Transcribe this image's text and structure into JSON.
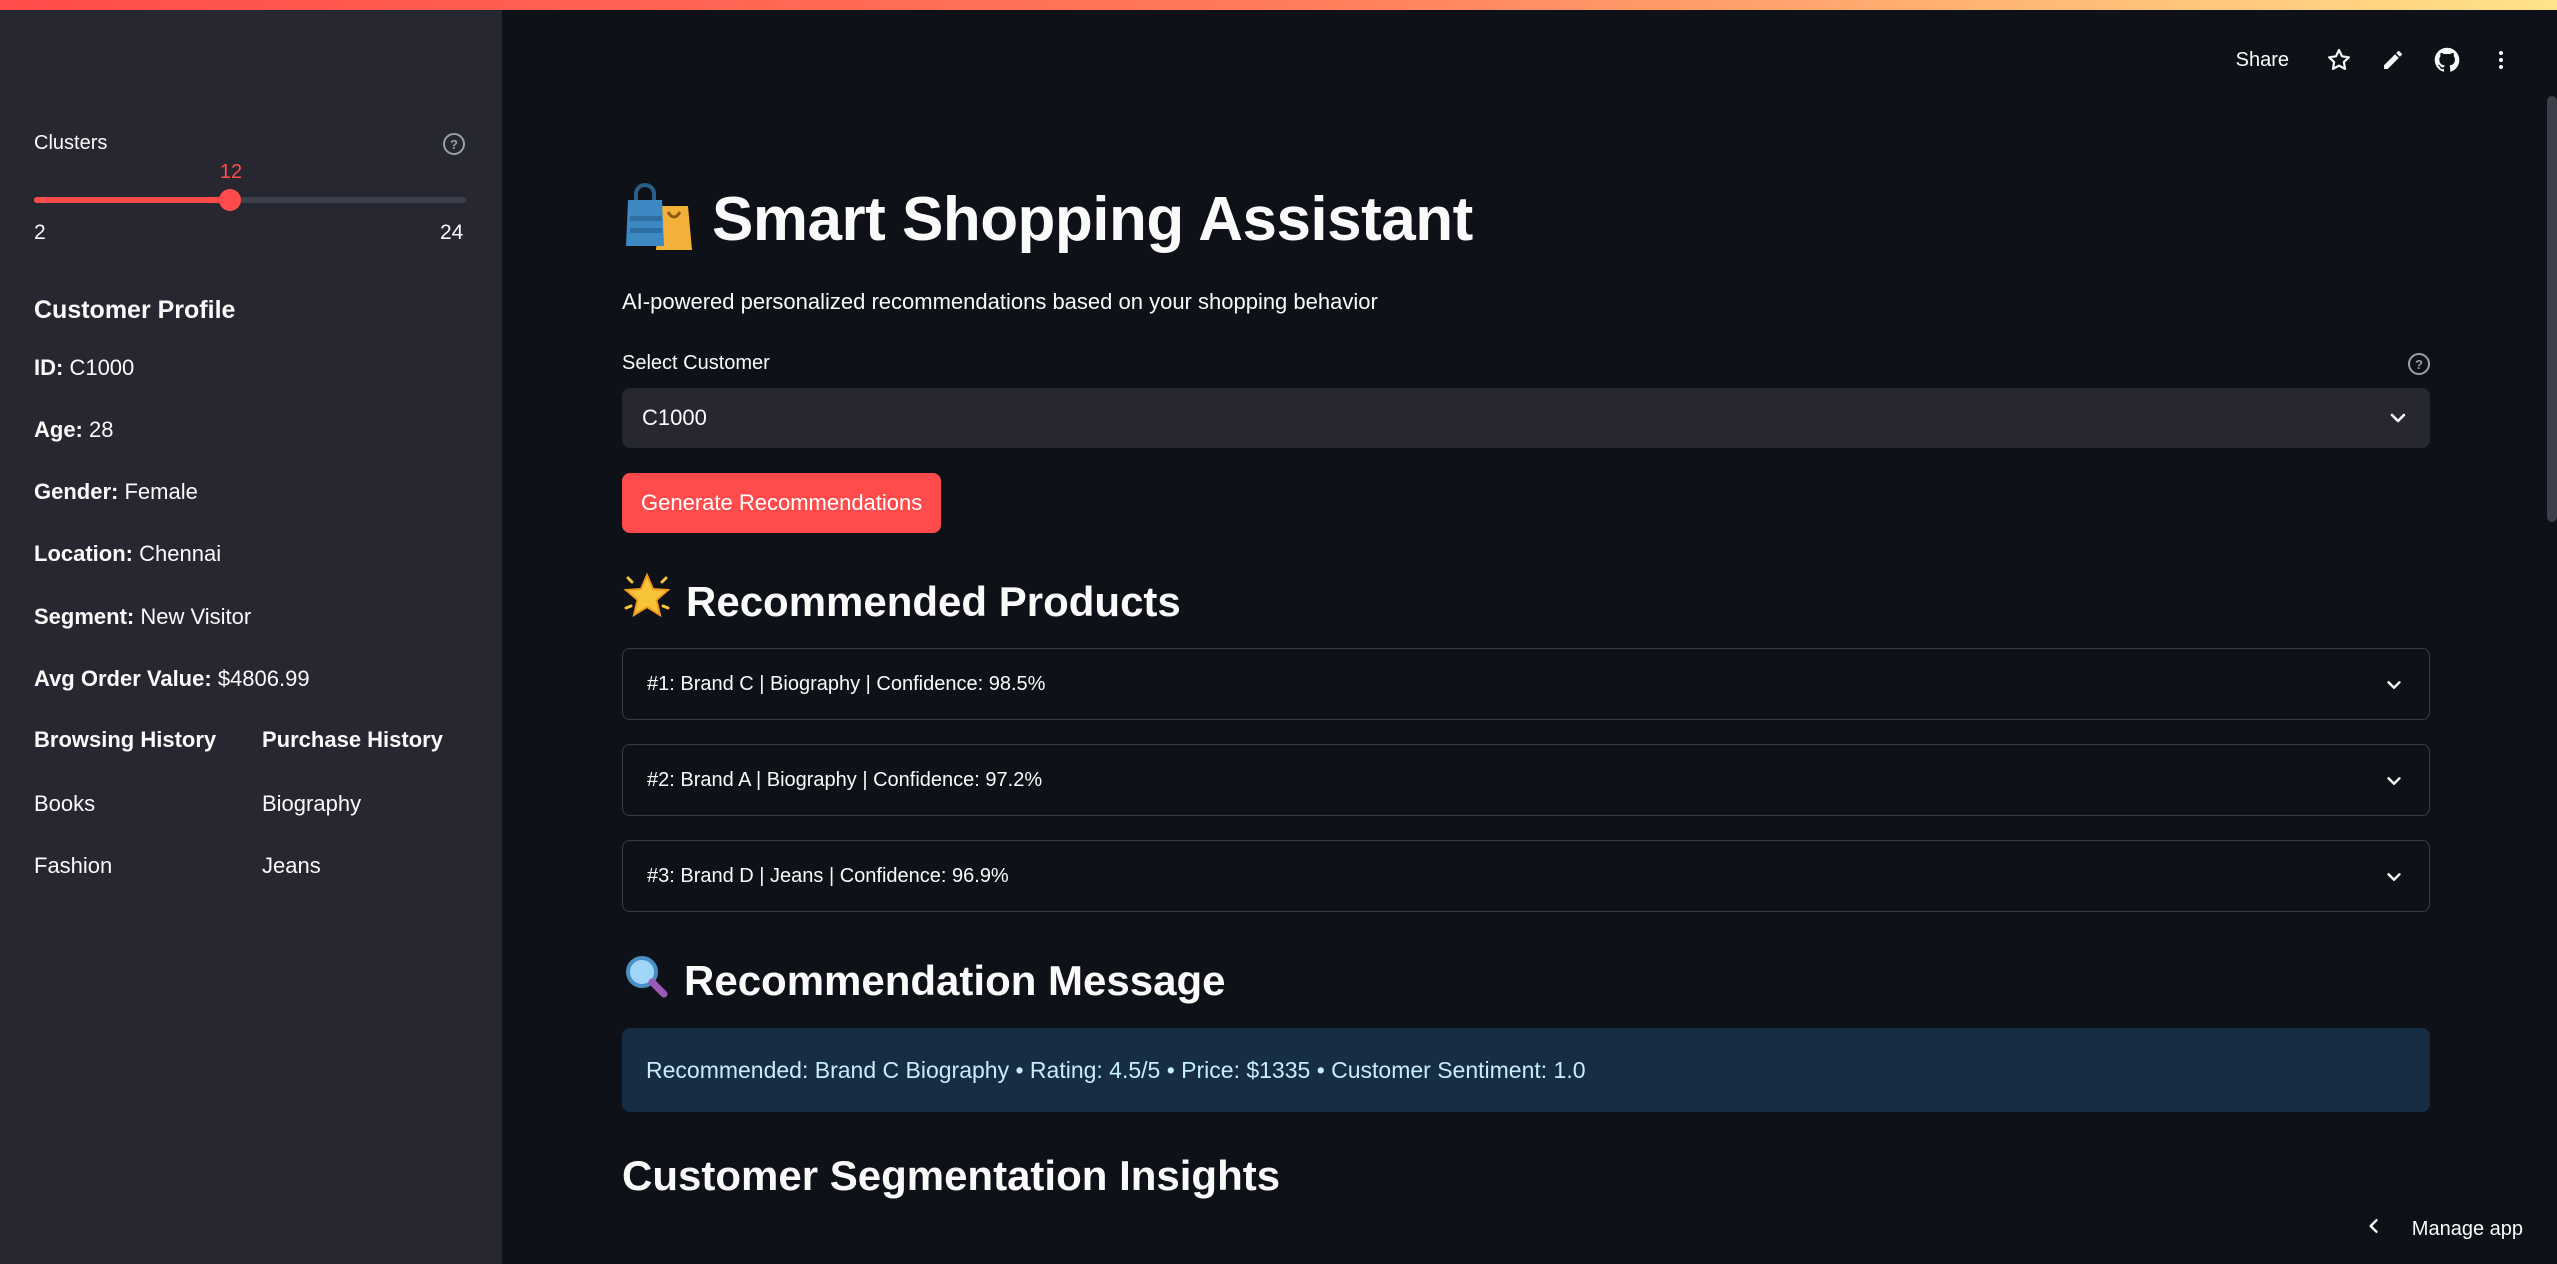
{
  "sidebar": {
    "slider": {
      "label": "Clusters",
      "value": "12",
      "min": "2",
      "max": "24",
      "fraction": 0.4545
    },
    "profile": {
      "title": "Customer Profile",
      "rows": [
        {
          "key": "ID:",
          "value": "C1000"
        },
        {
          "key": "Age:",
          "value": "28"
        },
        {
          "key": "Gender:",
          "value": "Female"
        },
        {
          "key": "Location:",
          "value": "Chennai"
        },
        {
          "key": "Segment:",
          "value": "New Visitor"
        },
        {
          "key": "Avg Order Value:",
          "value": "$4806.99"
        }
      ]
    },
    "browsing": {
      "title": "Browsing History",
      "items": [
        "Books",
        "Fashion"
      ]
    },
    "purchase": {
      "title": "Purchase History",
      "items": [
        "Biography",
        "Jeans"
      ]
    }
  },
  "header": {
    "share_label": "Share"
  },
  "main": {
    "title": "Smart Shopping Assistant",
    "subtitle": "AI-powered personalized recommendations based on your shopping behavior",
    "select": {
      "label": "Select Customer",
      "value": "C1000"
    },
    "generate_label": "Generate Recommendations",
    "recommended_title": "Recommended Products",
    "recommendations": [
      "#1: Brand C | Biography | Confidence: 98.5%",
      "#2: Brand A | Biography | Confidence: 97.2%",
      "#3: Brand D | Jeans | Confidence: 96.9%"
    ],
    "message_title": "Recommendation Message",
    "message": "Recommended: Brand C Biography • Rating: 4.5/5 • Price: $1335 • Customer Sentiment: 1.0",
    "segmentation_title": "Customer Segmentation Insights"
  },
  "footer": {
    "manage_label": "Manage app"
  },
  "colors": {
    "accent": "#ff4b4b",
    "sidebar_bg": "#262730",
    "main_bg": "#0e1117",
    "info_bg": "#172d43"
  }
}
